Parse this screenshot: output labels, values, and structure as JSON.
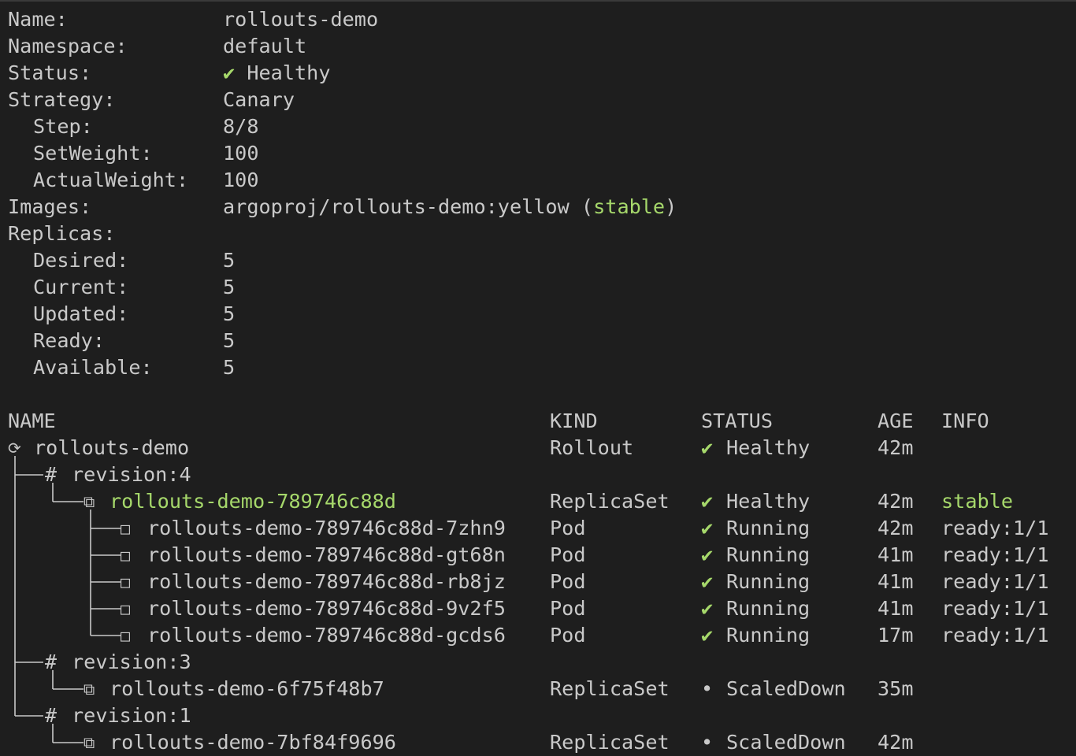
{
  "summary": [
    {
      "label": "Name:",
      "value": "rollouts-demo",
      "indent": 0
    },
    {
      "label": "Namespace:",
      "value": "default",
      "indent": 0
    },
    {
      "label": "Status:",
      "value": "Healthy",
      "indent": 0,
      "check": true
    },
    {
      "label": "Strategy:",
      "value": "Canary",
      "indent": 0
    },
    {
      "label": "Step:",
      "value": "8/8",
      "indent": 1
    },
    {
      "label": "SetWeight:",
      "value": "100",
      "indent": 1
    },
    {
      "label": "ActualWeight:",
      "value": "100",
      "indent": 1
    },
    {
      "label": "Images:",
      "value": "argoproj/rollouts-demo:yellow",
      "indent": 0,
      "tag": "stable"
    },
    {
      "label": "Replicas:",
      "value": "",
      "indent": 0
    },
    {
      "label": "Desired:",
      "value": "5",
      "indent": 1
    },
    {
      "label": "Current:",
      "value": "5",
      "indent": 1
    },
    {
      "label": "Updated:",
      "value": "5",
      "indent": 1
    },
    {
      "label": "Ready:",
      "value": "5",
      "indent": 1
    },
    {
      "label": "Available:",
      "value": "5",
      "indent": 1
    }
  ],
  "table": {
    "headers": {
      "name": "NAME",
      "kind": "KIND",
      "status": "STATUS",
      "age": "AGE",
      "info": "INFO"
    },
    "rows": [
      {
        "icon": "rollout-icon",
        "name": "rollouts-demo",
        "kind": "Rollout",
        "status_mark": "✔",
        "status": "Healthy",
        "age": "42m",
        "info": "",
        "level": 0,
        "highlight": false
      },
      {
        "icon": "revision-hash",
        "name": "revision:4",
        "kind": "",
        "status_mark": "",
        "status": "",
        "age": "",
        "info": "",
        "level": 1,
        "highlight": false
      },
      {
        "icon": "replicaset-icon",
        "name": "rollouts-demo-789746c88d",
        "kind": "ReplicaSet",
        "status_mark": "✔",
        "status": "Healthy",
        "age": "42m",
        "info": "stable",
        "level": 2,
        "highlight": true
      },
      {
        "icon": "pod-icon",
        "name": "rollouts-demo-789746c88d-7zhn9",
        "kind": "Pod",
        "status_mark": "✔",
        "status": "Running",
        "age": "42m",
        "info": "ready:1/1",
        "level": 3,
        "highlight": false
      },
      {
        "icon": "pod-icon",
        "name": "rollouts-demo-789746c88d-gt68n",
        "kind": "Pod",
        "status_mark": "✔",
        "status": "Running",
        "age": "41m",
        "info": "ready:1/1",
        "level": 3,
        "highlight": false
      },
      {
        "icon": "pod-icon",
        "name": "rollouts-demo-789746c88d-rb8jz",
        "kind": "Pod",
        "status_mark": "✔",
        "status": "Running",
        "age": "41m",
        "info": "ready:1/1",
        "level": 3,
        "highlight": false
      },
      {
        "icon": "pod-icon",
        "name": "rollouts-demo-789746c88d-9v2f5",
        "kind": "Pod",
        "status_mark": "✔",
        "status": "Running",
        "age": "41m",
        "info": "ready:1/1",
        "level": 3,
        "highlight": false
      },
      {
        "icon": "pod-icon",
        "name": "rollouts-demo-789746c88d-gcds6",
        "kind": "Pod",
        "status_mark": "✔",
        "status": "Running",
        "age": "17m",
        "info": "ready:1/1",
        "level": 3,
        "highlight": false
      },
      {
        "icon": "revision-hash",
        "name": "revision:3",
        "kind": "",
        "status_mark": "",
        "status": "",
        "age": "",
        "info": "",
        "level": 1,
        "highlight": false
      },
      {
        "icon": "replicaset-icon",
        "name": "rollouts-demo-6f75f48b7",
        "kind": "ReplicaSet",
        "status_mark": "•",
        "status": "ScaledDown",
        "age": "35m",
        "info": "",
        "level": 2,
        "highlight": false
      },
      {
        "icon": "revision-hash",
        "name": "revision:1",
        "kind": "",
        "status_mark": "",
        "status": "",
        "age": "",
        "info": "",
        "level": 1,
        "highlight": false
      },
      {
        "icon": "replicaset-icon",
        "name": "rollouts-demo-7bf84f9696",
        "kind": "ReplicaSet",
        "status_mark": "•",
        "status": "ScaledDown",
        "age": "42m",
        "info": "",
        "level": 2,
        "highlight": false
      }
    ]
  },
  "colors": {
    "background": "#1e1e1e",
    "text": "#c9c9c9",
    "accent_green": "#a6d86b"
  }
}
